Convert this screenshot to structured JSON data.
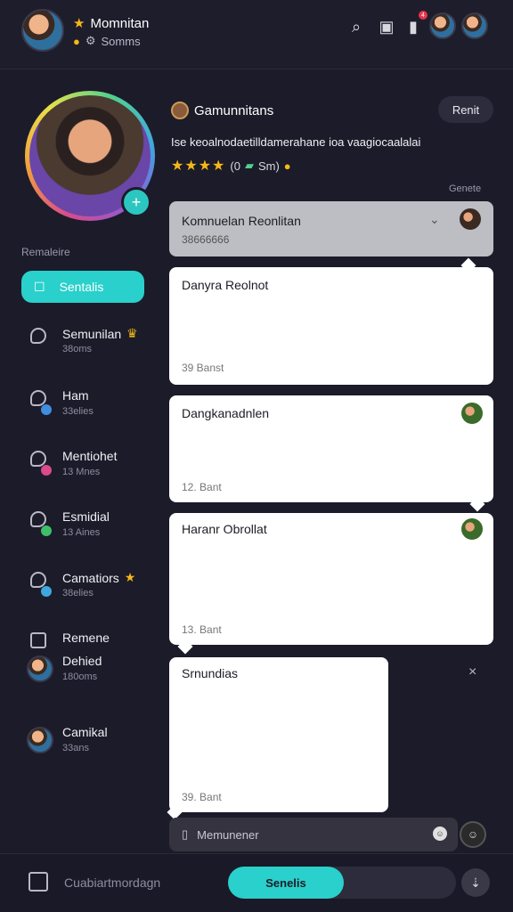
{
  "profile": {
    "name": "Momnitan",
    "sub_label": "Somms"
  },
  "topbar": {
    "notification_count": "4"
  },
  "sidebar": {
    "section_label": "Remaleire",
    "active_item": "Sentalis",
    "items": [
      {
        "title": "Semunilan",
        "sub": "38oms"
      },
      {
        "title": "Ham",
        "sub": "33elies"
      },
      {
        "title": "Mentiohet",
        "sub": "13 Mnes"
      },
      {
        "title": "Esmidial",
        "sub": "13 Aines"
      },
      {
        "title": "Camatiors",
        "sub": "38elies"
      },
      {
        "title": "Remene",
        "sub": ""
      }
    ],
    "people": [
      {
        "title": "Dehied",
        "sub": "180oms"
      },
      {
        "title": "Camikal",
        "sub": "33ans"
      }
    ]
  },
  "chat": {
    "title": "Gamunnitans",
    "header_button": "Renit",
    "description": "Ise keoalnodaetilldamerahane ioa vaagiocaalalai",
    "rating_text": "(0",
    "rating_extra": "Sm)",
    "corner_label": "Genete",
    "pinned": {
      "title": "Komnuelan Reonlitan",
      "sub": "38666666"
    },
    "cards": [
      {
        "title": "Danyra Reolnot",
        "time": "39 Banst"
      },
      {
        "title": "Dangkanadnlen",
        "time": "12. Bant"
      },
      {
        "title": "Haranr Obrollat",
        "time": "13. Bant"
      },
      {
        "title": "Srnundias",
        "time": "39. Bant"
      }
    ],
    "compose_placeholder": "Memunener"
  },
  "bottombar": {
    "left_text": "Cuabiartmordagn",
    "switch_label": "Senelis"
  }
}
